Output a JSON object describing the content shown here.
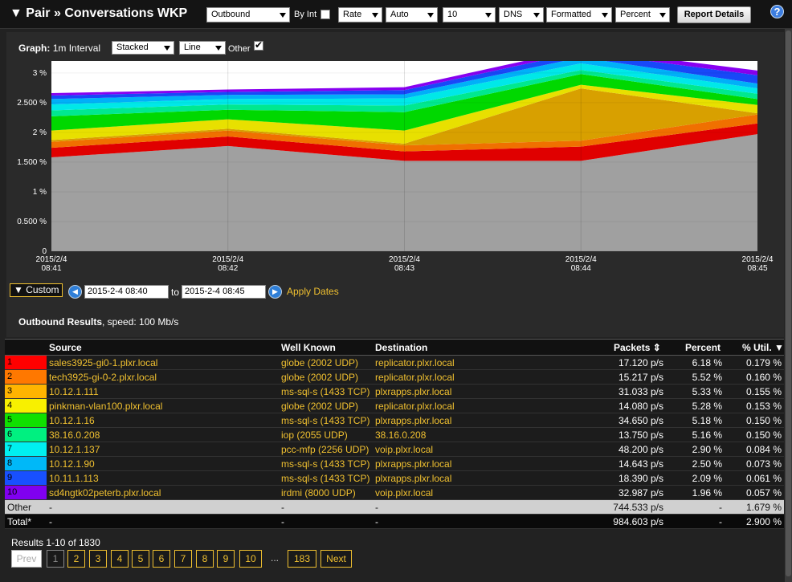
{
  "header": {
    "title": "▼ Pair » Conversations WKP",
    "direction": "Outbound",
    "by_int_label": "By Int",
    "rate": "Rate",
    "auto": "Auto",
    "count": "10",
    "dns": "DNS",
    "format": "Formatted",
    "percent": "Percent",
    "report_details": "Report Details",
    "help": "?"
  },
  "graph": {
    "label": "Graph:",
    "interval": "1m Interval",
    "stack_mode": "Stacked",
    "line_mode": "Line",
    "other_label": "Other",
    "other_checked": true
  },
  "chart_data": {
    "type": "area",
    "stacked": true,
    "x": [
      "2015/2/4 08:41",
      "2015/2/4 08:42",
      "2015/2/4 08:43",
      "2015/2/4 08:44",
      "2015/2/4 08:45"
    ],
    "x_ticks": [
      {
        "date": "2015/2/4",
        "time": "08:41"
      },
      {
        "date": "2015/2/4",
        "time": "08:42"
      },
      {
        "date": "2015/2/4",
        "time": "08:43"
      },
      {
        "date": "2015/2/4",
        "time": "08:44"
      },
      {
        "date": "2015/2/4",
        "time": "08:45"
      }
    ],
    "y_ticks": [
      "0",
      "0.500 %",
      "1 %",
      "1.500 %",
      "2 %",
      "2.500 %",
      "3 %"
    ],
    "ylim": [
      0,
      3.2
    ],
    "series": [
      {
        "color": "#a0a0a0",
        "values": [
          1.58,
          1.77,
          1.52,
          1.52,
          1.97
        ]
      },
      {
        "color": "#e00000",
        "values": [
          0.16,
          0.16,
          0.16,
          0.24,
          0.18
        ]
      },
      {
        "color": "#f07000",
        "values": [
          0.1,
          0.1,
          0.1,
          0.1,
          0.15
        ]
      },
      {
        "color": "#d8a000",
        "values": [
          0.03,
          0.03,
          0.03,
          0.88,
          0.02
        ]
      },
      {
        "color": "#e8e000",
        "values": [
          0.16,
          0.16,
          0.22,
          0.06,
          0.14
        ]
      },
      {
        "color": "#00d800",
        "values": [
          0.24,
          0.16,
          0.31,
          0.18,
          0.1
        ]
      },
      {
        "color": "#00e890",
        "values": [
          0.1,
          0.09,
          0.11,
          0.07,
          0.09
        ]
      },
      {
        "color": "#00e8e8",
        "values": [
          0.1,
          0.09,
          0.12,
          0.11,
          0.09
        ]
      },
      {
        "color": "#00b0f8",
        "values": [
          0.09,
          0.07,
          0.07,
          0.1,
          0.08
        ]
      },
      {
        "color": "#1848f8",
        "values": [
          0.06,
          0.05,
          0.07,
          0.09,
          0.14
        ]
      },
      {
        "color": "#8800f0",
        "values": [
          0.04,
          0.04,
          0.05,
          0.06,
          0.08
        ]
      }
    ]
  },
  "dates": {
    "range_type": "▼ Custom",
    "from": "2015-2-4 08:40",
    "to_label": "to",
    "to": "2015-2-4 08:45",
    "prev_arrow": "◀",
    "next_arrow": "▶",
    "apply": "Apply Dates"
  },
  "results": {
    "title": "Outbound Results",
    "speed": ", speed: 100 Mb/s",
    "columns": {
      "source": "Source",
      "well_known": "Well Known",
      "destination": "Destination",
      "packets": "Packets",
      "packets_sort": "⇕",
      "percent": "Percent",
      "util": "% Util.",
      "util_sort": "▼"
    },
    "rows": [
      {
        "n": "1",
        "color": "#ff0000",
        "source": "sales3925-gi0-1.plxr.local",
        "wk": "globe (2002 UDP)",
        "dest": "replicator.plxr.local",
        "packets": "17.120 p/s",
        "percent": "6.18 %",
        "util": "0.179 %"
      },
      {
        "n": "2",
        "color": "#ff7800",
        "source": "tech3925-gi-0-2.plxr.local",
        "wk": "globe (2002 UDP)",
        "dest": "replicator.plxr.local",
        "packets": "15.217 p/s",
        "percent": "5.52 %",
        "util": "0.160 %"
      },
      {
        "n": "3",
        "color": "#ffb400",
        "source": "10.12.1.111",
        "wk": "ms-sql-s (1433 TCP)",
        "dest": "plxrapps.plxr.local",
        "packets": "31.033 p/s",
        "percent": "5.33 %",
        "util": "0.155 %"
      },
      {
        "n": "4",
        "color": "#f8f000",
        "source": "pinkman-vlan100.plxr.local",
        "wk": "globe (2002 UDP)",
        "dest": "replicator.plxr.local",
        "packets": "14.080 p/s",
        "percent": "5.28 %",
        "util": "0.153 %"
      },
      {
        "n": "5",
        "color": "#10e000",
        "source": "10.12.1.16",
        "wk": "ms-sql-s (1433 TCP)",
        "dest": "plxrapps.plxr.local",
        "packets": "34.650 p/s",
        "percent": "5.18 %",
        "util": "0.150 %"
      },
      {
        "n": "6",
        "color": "#00f080",
        "source": "38.16.0.208",
        "wk": "iop (2055 UDP)",
        "dest": "38.16.0.208",
        "packets": "13.750 p/s",
        "percent": "5.16 %",
        "util": "0.150 %"
      },
      {
        "n": "7",
        "color": "#00f0f0",
        "source": "10.12.1.137",
        "wk": "pcc-mfp (2256 UDP)",
        "dest": "voip.plxr.local",
        "packets": "48.200 p/s",
        "percent": "2.90 %",
        "util": "0.084 %"
      },
      {
        "n": "8",
        "color": "#00b8f8",
        "source": "10.12.1.90",
        "wk": "ms-sql-s (1433 TCP)",
        "dest": "plxrapps.plxr.local",
        "packets": "14.643 p/s",
        "percent": "2.50 %",
        "util": "0.073 %"
      },
      {
        "n": "9",
        "color": "#1850ff",
        "source": "10.11.1.113",
        "wk": "ms-sql-s (1433 TCP)",
        "dest": "plxrapps.plxr.local",
        "packets": "18.390 p/s",
        "percent": "2.09 %",
        "util": "0.061 %"
      },
      {
        "n": "10",
        "color": "#8000f0",
        "source": "sd4ngtk02peterb.plxr.local",
        "wk": "irdmi (8000 UDP)",
        "dest": "voip.plxr.local",
        "packets": "32.987 p/s",
        "percent": "1.96 %",
        "util": "0.057 %"
      }
    ],
    "other": {
      "label": "Other",
      "source": "-",
      "wk": "-",
      "dest": "-",
      "packets": "744.533 p/s",
      "percent": "-",
      "util": "1.679 %"
    },
    "total": {
      "label": "Total*",
      "source": "-",
      "wk": "-",
      "dest": "-",
      "packets": "984.603 p/s",
      "percent": "-",
      "util": "2.900 %"
    }
  },
  "pagination": {
    "summary": "Results 1-10 of 1830",
    "prev": "Prev",
    "pages": [
      "1",
      "2",
      "3",
      "4",
      "5",
      "6",
      "7",
      "8",
      "9",
      "10"
    ],
    "ellipsis": "...",
    "last": "183",
    "next": "Next"
  }
}
